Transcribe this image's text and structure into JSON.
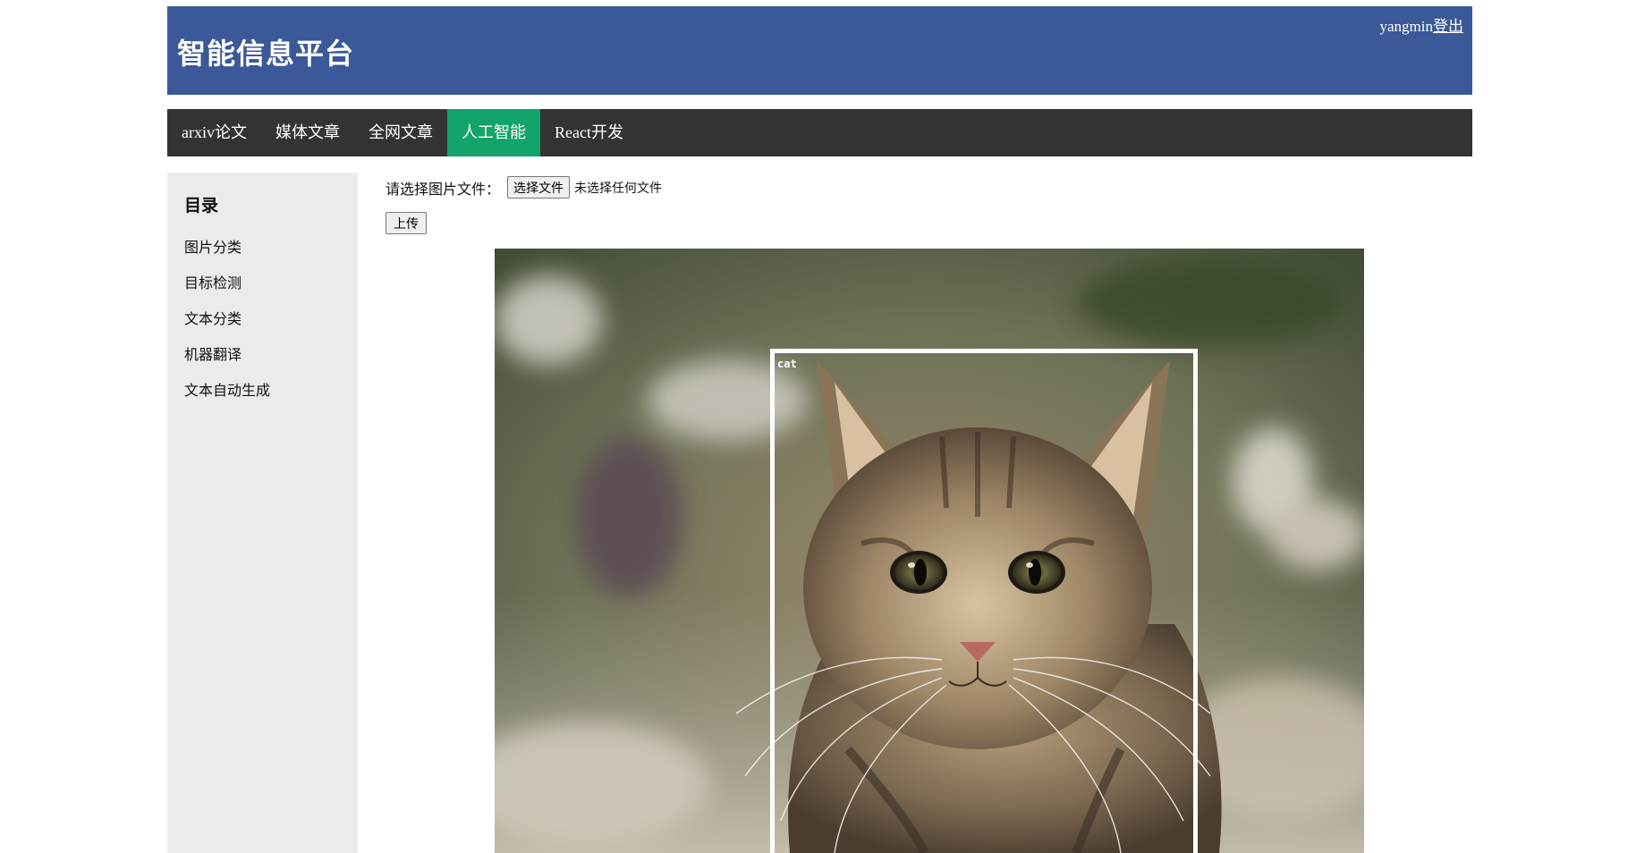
{
  "header": {
    "site_title": "智能信息平台",
    "username": "yangmin",
    "logout_label": "登出",
    "background_color": "#3b5998"
  },
  "nav": {
    "items": [
      {
        "label": "arxiv论文",
        "active": false
      },
      {
        "label": "媒体文章",
        "active": false
      },
      {
        "label": "全网文章",
        "active": false
      },
      {
        "label": "人工智能",
        "active": true
      },
      {
        "label": "React开发",
        "active": false
      }
    ],
    "background_color": "#333333",
    "active_color": "#13a46b"
  },
  "sidebar": {
    "title": "目录",
    "items": [
      {
        "label": "图片分类"
      },
      {
        "label": "目标检测"
      },
      {
        "label": "文本分类"
      },
      {
        "label": "机器翻译"
      },
      {
        "label": "文本自动生成"
      }
    ]
  },
  "main": {
    "file_prompt": "请选择图片文件：",
    "choose_button_label": "选择文件",
    "no_file_text": "未选择任何文件",
    "upload_button_label": "上传",
    "detection": {
      "image_subject": "kitten",
      "label": "cat",
      "box_color": "#ffffff"
    }
  }
}
